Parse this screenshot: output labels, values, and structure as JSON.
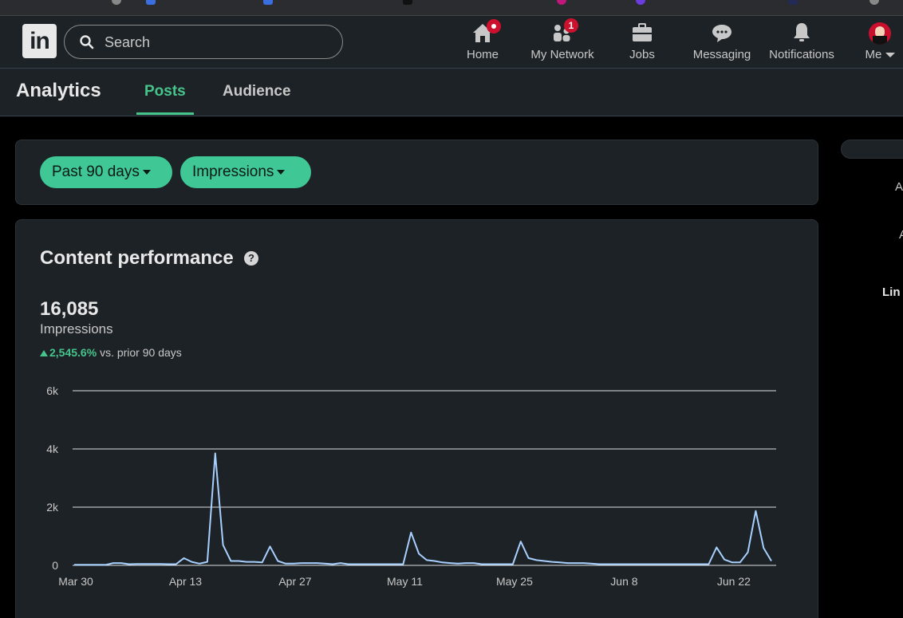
{
  "nav": {
    "logo": "in",
    "search_placeholder": "Search",
    "items": [
      {
        "label": "Home",
        "icon": "home-icon",
        "badge": ""
      },
      {
        "label": "My Network",
        "icon": "network-icon",
        "badge": "1"
      },
      {
        "label": "Jobs",
        "icon": "briefcase-icon",
        "badge": ""
      },
      {
        "label": "Messaging",
        "icon": "messaging-icon",
        "badge": ""
      },
      {
        "label": "Notifications",
        "icon": "bell-icon",
        "badge": ""
      },
      {
        "label": "Me",
        "icon": "avatar",
        "badge": ""
      }
    ]
  },
  "subnav": {
    "title": "Analytics",
    "tabs": [
      "Posts",
      "Audience"
    ],
    "active_tab": "Posts"
  },
  "filters": {
    "range": "Past 90 days",
    "metric": "Impressions"
  },
  "performance": {
    "title": "Content performance",
    "total": "16,085",
    "metric_label": "Impressions",
    "change_value": "2,545.6%",
    "change_text": "vs. prior 90 days"
  },
  "right_panel": {
    "lines": [
      "A",
      "A",
      "Lin"
    ]
  },
  "colors": {
    "accent": "#46c48c",
    "line": "#a8d0ff",
    "badge": "#cb112d"
  },
  "chart_data": {
    "type": "line",
    "title": "",
    "xlabel": "",
    "ylabel": "",
    "ylim": [
      0,
      6000
    ],
    "yticks": [
      0,
      2000,
      4000,
      6000
    ],
    "ytick_labels": [
      "0",
      "2k",
      "4k",
      "6k"
    ],
    "xtick_labels": [
      "Mar 30",
      "Apr 13",
      "Apr 27",
      "May 11",
      "May 25",
      "Jun 8",
      "Jun 22"
    ],
    "grid": true,
    "series": [
      {
        "values": [
          20,
          20,
          20,
          20,
          20,
          80,
          80,
          40,
          50,
          50,
          50,
          50,
          40,
          40,
          250,
          120,
          60,
          120,
          3850,
          700,
          150,
          150,
          120,
          120,
          100,
          650,
          150,
          60,
          60,
          80,
          80,
          80,
          60,
          40,
          80,
          40,
          40,
          40,
          40,
          40,
          40,
          40,
          40,
          1130,
          400,
          180,
          150,
          100,
          80,
          60,
          80,
          80,
          40,
          40,
          40,
          40,
          40,
          820,
          250,
          180,
          150,
          120,
          100,
          80,
          80,
          80,
          60,
          40,
          40,
          40,
          40,
          40,
          40,
          40,
          40,
          40,
          40,
          40,
          40,
          40,
          40,
          40,
          620,
          200,
          100,
          100,
          450,
          1870,
          600,
          150
        ]
      }
    ]
  }
}
